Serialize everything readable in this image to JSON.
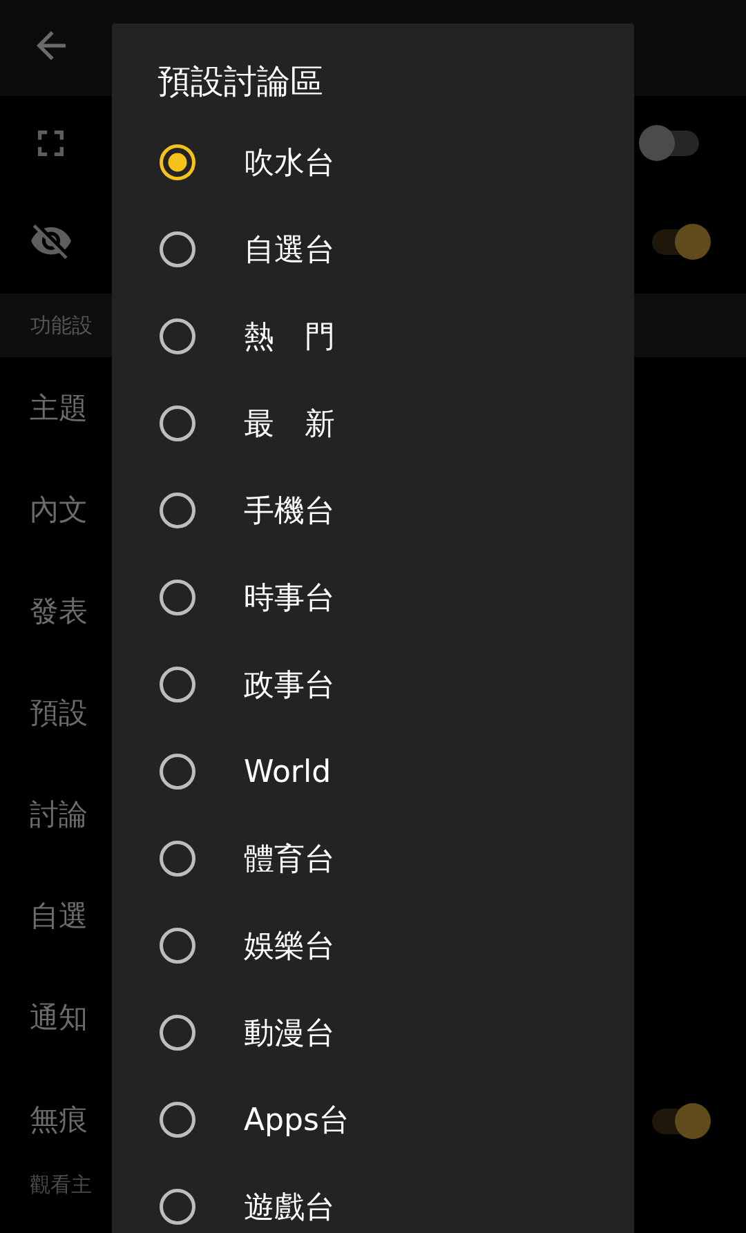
{
  "switch_rows": [
    {
      "on": false
    },
    {
      "on": true
    }
  ],
  "section_header": {
    "label": "功能設"
  },
  "settings": [
    {
      "kind": "link",
      "label": "主題"
    },
    {
      "kind": "link",
      "label": "內文"
    },
    {
      "kind": "link",
      "label": "發表"
    },
    {
      "kind": "link",
      "label": "預設"
    },
    {
      "kind": "link",
      "label": "討論"
    },
    {
      "kind": "link",
      "label": "自選"
    },
    {
      "kind": "link",
      "label": "通知"
    },
    {
      "kind": "toggle",
      "label": "無痕",
      "description": "觀看主",
      "on": true
    }
  ],
  "dialog": {
    "title": "預設討論區",
    "options": [
      {
        "label": "吹水台",
        "selected": true
      },
      {
        "label": "自選台",
        "selected": false
      },
      {
        "label": "熱　門",
        "selected": false
      },
      {
        "label": "最　新",
        "selected": false
      },
      {
        "label": "手機台",
        "selected": false
      },
      {
        "label": "時事台",
        "selected": false
      },
      {
        "label": "政事台",
        "selected": false
      },
      {
        "label": "World",
        "selected": false
      },
      {
        "label": "體育台",
        "selected": false
      },
      {
        "label": "娛樂台",
        "selected": false
      },
      {
        "label": "動漫台",
        "selected": false
      },
      {
        "label": "Apps台",
        "selected": false
      },
      {
        "label": "遊戲台",
        "selected": false
      }
    ]
  }
}
